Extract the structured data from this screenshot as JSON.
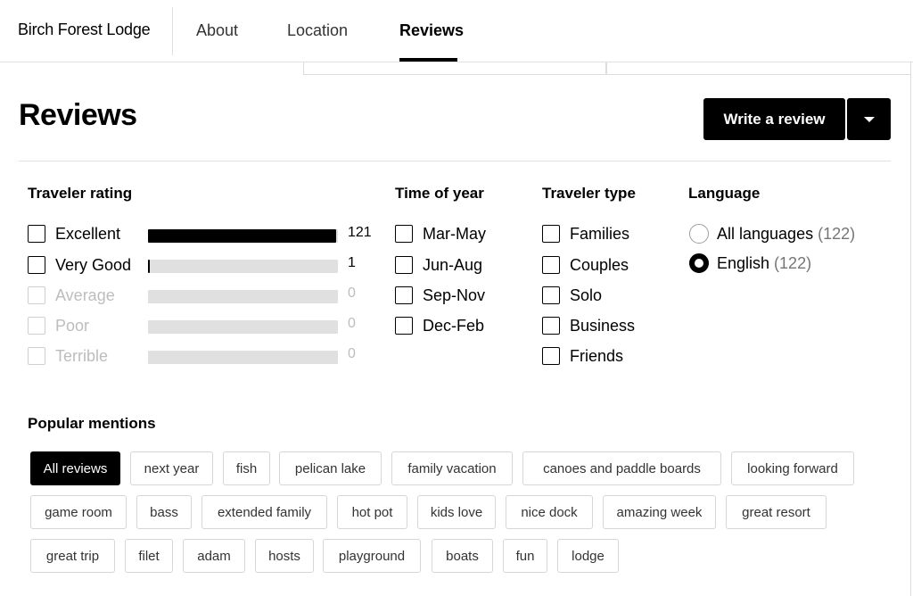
{
  "brand": "Birch Forest Lodge",
  "nav": {
    "about": "About",
    "location": "Location",
    "reviews": "Reviews"
  },
  "header": {
    "title": "Reviews",
    "write_label": "Write a review"
  },
  "filters": {
    "rating": {
      "title": "Traveler rating",
      "items": [
        {
          "label": "Excellent",
          "count": "121",
          "fraction": 0.99
        },
        {
          "label": "Very Good",
          "count": "1",
          "fraction": 0.01
        },
        {
          "label": "Average",
          "count": "0",
          "fraction": 0
        },
        {
          "label": "Poor",
          "count": "0",
          "fraction": 0
        },
        {
          "label": "Terrible",
          "count": "0",
          "fraction": 0
        }
      ]
    },
    "time": {
      "title": "Time of year",
      "items": [
        "Mar-May",
        "Jun-Aug",
        "Sep-Nov",
        "Dec-Feb"
      ]
    },
    "type": {
      "title": "Traveler type",
      "items": [
        "Families",
        "Couples",
        "Solo",
        "Business",
        "Friends"
      ]
    },
    "language": {
      "title": "Language",
      "items": [
        {
          "label": "All languages",
          "count": "(122)"
        },
        {
          "label": "English",
          "count": "(122)"
        }
      ]
    }
  },
  "mentions": {
    "title": "Popular mentions",
    "chips": [
      "All reviews",
      "next year",
      "fish",
      "pelican lake",
      "family vacation",
      "canoes and paddle boards",
      "looking forward",
      "game room",
      "bass",
      "extended family",
      "hot pot",
      "kids love",
      "nice dock",
      "amazing week",
      "great resort",
      "great trip",
      "filet",
      "adam",
      "hosts",
      "playground",
      "boats",
      "fun",
      "lodge"
    ]
  },
  "icons": {
    "dropdown": "caret-down-icon"
  }
}
